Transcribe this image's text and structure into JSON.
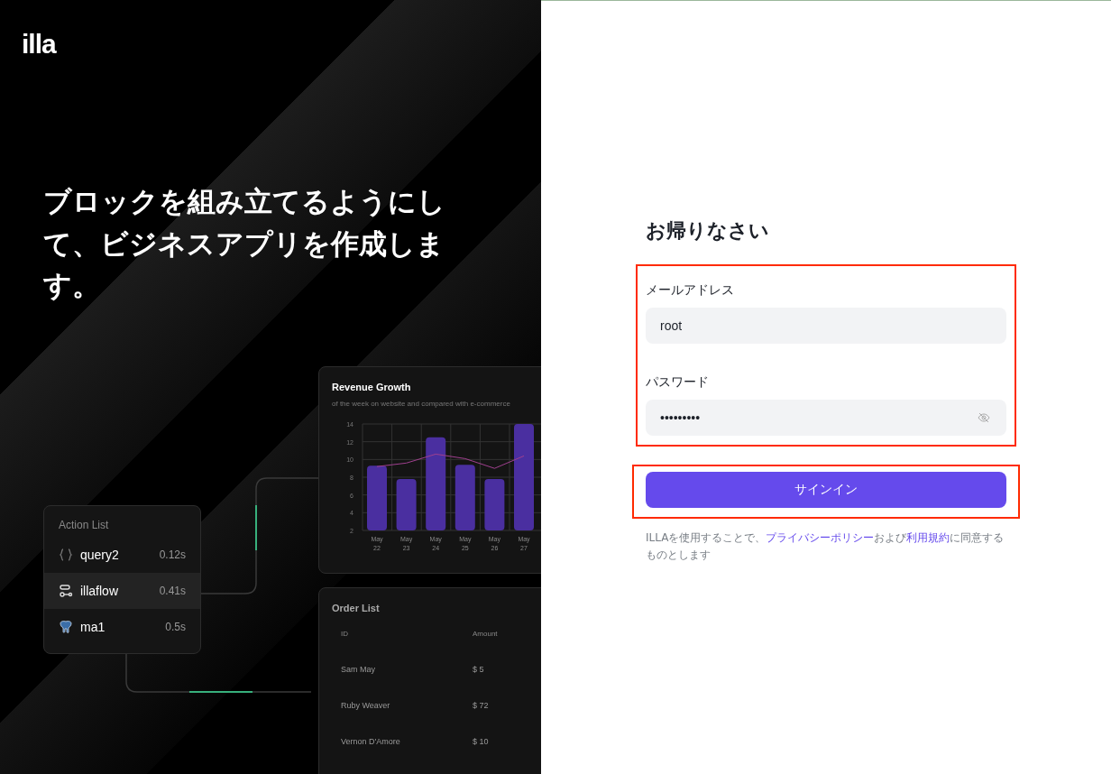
{
  "logo": "illa",
  "headline": "ブロックを組み立てるようにして、ビジネスアプリを作成します。",
  "revenue_card": {
    "title": "Revenue Growth",
    "subtitle": "of the week on website and compared with e-commerce",
    "chart_data": {
      "type": "bar",
      "categories": [
        "May\n22",
        "May\n23",
        "May\n24",
        "May\n25",
        "May\n26",
        "May\n27"
      ],
      "ylim": [
        2,
        14
      ],
      "yticks": [
        2,
        4,
        6,
        8,
        10,
        12,
        14
      ],
      "grid": true,
      "series": [
        {
          "color": "#4a2fa0",
          "values": [
            9.3,
            7.8,
            12.5,
            9.4,
            7.8,
            14
          ]
        },
        {
          "type": "line",
          "color": "#a0408f",
          "values": [
            9.2,
            9.6,
            10.6,
            10.1,
            9.0,
            10.4
          ]
        }
      ]
    }
  },
  "action_list": {
    "title": "Action List",
    "items": [
      {
        "kind": "query",
        "name": "query2",
        "time": "0.12s",
        "selected": false
      },
      {
        "kind": "flow",
        "name": "illaflow",
        "time": "0.41s",
        "selected": true
      },
      {
        "kind": "database",
        "name": "ma1",
        "time": "0.5s",
        "selected": false
      }
    ]
  },
  "order_list": {
    "title": "Order List",
    "columns": [
      "ID",
      "Amount"
    ],
    "rows": [
      [
        "Sam May",
        "$ 5"
      ],
      [
        "Ruby Weaver",
        "$ 72"
      ],
      [
        "Vernon D'Amore",
        "$ 10"
      ]
    ]
  },
  "form": {
    "title": "お帰りなさい",
    "highlighted": true,
    "fields": [
      {
        "kind": "text",
        "label": "メールアドレス",
        "value": "root"
      },
      {
        "kind": "password",
        "label": "パスワード",
        "value": "•••••••••"
      }
    ],
    "button": {
      "label": "サインイン",
      "highlighted": true
    },
    "terms": {
      "before": "ILLAを使用することで、",
      "privacy_link": "プライバシーポリシー",
      "middle": "および",
      "terms_link": "利用規約",
      "after": "に同意するものとします"
    }
  }
}
